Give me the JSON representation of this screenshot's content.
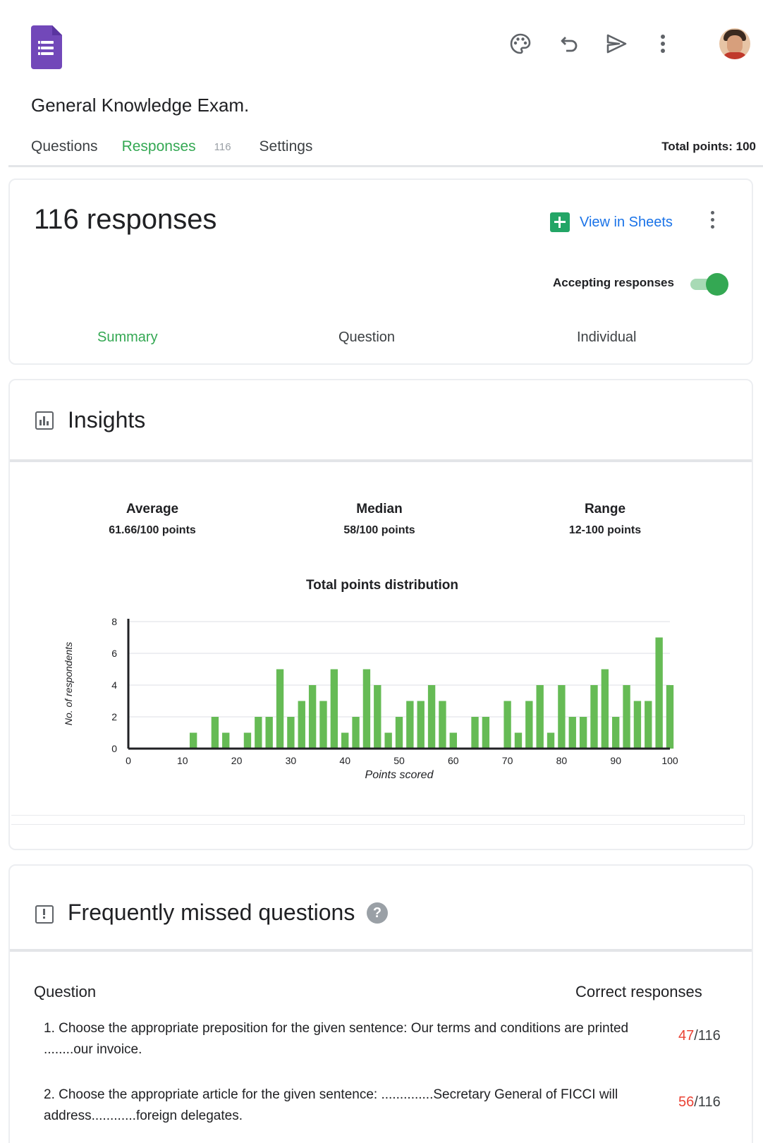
{
  "header": {
    "form_title": "General Knowledge Exam.",
    "tabs": [
      {
        "label": "Questions"
      },
      {
        "label": "Responses",
        "count": "116"
      },
      {
        "label": "Settings"
      }
    ],
    "total_points": "Total points: 100",
    "icons": [
      "palette-icon",
      "undo-icon",
      "send-icon",
      "more-vert-icon",
      "avatar"
    ]
  },
  "responses": {
    "count_title": "116 responses",
    "view_in_sheets": "View in Sheets",
    "accepting_label": "Accepting responses",
    "accepting": true,
    "subtabs": [
      {
        "label": "Summary"
      },
      {
        "label": "Question"
      },
      {
        "label": "Individual"
      }
    ]
  },
  "insights": {
    "title": "Insights",
    "stats": [
      {
        "label": "Average",
        "value": "61.66/100 points"
      },
      {
        "label": "Median",
        "value": "58/100 points"
      },
      {
        "label": "Range",
        "value": "12-100 points"
      }
    ]
  },
  "chart_data": {
    "type": "bar",
    "title": "Total points distribution",
    "xlabel": "Points scored",
    "ylabel": "No. of respondents",
    "xlim": [
      0,
      100
    ],
    "ylim": [
      0,
      8
    ],
    "xticks": [
      0,
      10,
      20,
      30,
      40,
      50,
      60,
      70,
      80,
      90,
      100
    ],
    "yticks": [
      0,
      2,
      4,
      6,
      8
    ],
    "grid": true,
    "color": "#66bb55",
    "points": [
      {
        "x": 12,
        "y": 1
      },
      {
        "x": 16,
        "y": 2
      },
      {
        "x": 18,
        "y": 1
      },
      {
        "x": 22,
        "y": 1
      },
      {
        "x": 24,
        "y": 2
      },
      {
        "x": 26,
        "y": 2
      },
      {
        "x": 28,
        "y": 5
      },
      {
        "x": 30,
        "y": 2
      },
      {
        "x": 32,
        "y": 3
      },
      {
        "x": 34,
        "y": 4
      },
      {
        "x": 36,
        "y": 3
      },
      {
        "x": 38,
        "y": 5
      },
      {
        "x": 40,
        "y": 1
      },
      {
        "x": 42,
        "y": 2
      },
      {
        "x": 44,
        "y": 5
      },
      {
        "x": 46,
        "y": 4
      },
      {
        "x": 48,
        "y": 1
      },
      {
        "x": 50,
        "y": 2
      },
      {
        "x": 52,
        "y": 3
      },
      {
        "x": 54,
        "y": 3
      },
      {
        "x": 56,
        "y": 4
      },
      {
        "x": 58,
        "y": 3
      },
      {
        "x": 60,
        "y": 1
      },
      {
        "x": 64,
        "y": 2
      },
      {
        "x": 66,
        "y": 2
      },
      {
        "x": 70,
        "y": 3
      },
      {
        "x": 72,
        "y": 1
      },
      {
        "x": 74,
        "y": 3
      },
      {
        "x": 76,
        "y": 4
      },
      {
        "x": 78,
        "y": 1
      },
      {
        "x": 80,
        "y": 4
      },
      {
        "x": 82,
        "y": 2
      },
      {
        "x": 84,
        "y": 2
      },
      {
        "x": 86,
        "y": 4
      },
      {
        "x": 88,
        "y": 5
      },
      {
        "x": 90,
        "y": 2
      },
      {
        "x": 92,
        "y": 4
      },
      {
        "x": 94,
        "y": 3
      },
      {
        "x": 96,
        "y": 3
      },
      {
        "x": 98,
        "y": 7
      },
      {
        "x": 100,
        "y": 4
      }
    ]
  },
  "missed": {
    "title": "Frequently missed questions",
    "col_question": "Question",
    "col_correct": "Correct responses",
    "questions": [
      {
        "text": "1. Choose the appropriate preposition for the given sentence: Our terms and conditions are printed ........our invoice.",
        "correct": "47",
        "total": "/116"
      },
      {
        "text": "2. Choose the appropriate article for the given sentence: ..............Secretary General of FICCI will address............foreign delegates.",
        "correct": "56",
        "total": "/116"
      }
    ]
  }
}
